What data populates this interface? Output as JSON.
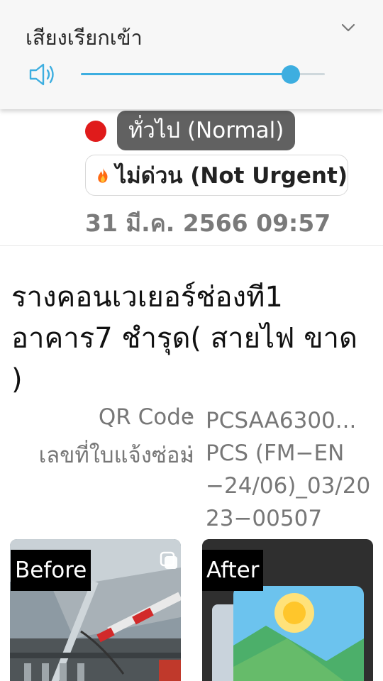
{
  "volume_panel": {
    "title": "เสียงเรียกเข้า",
    "level": 0.86
  },
  "status": {
    "type_label": "ทั่วไป (Normal)",
    "status_dot_color": "#e01b1b",
    "priority_label": "ไม่ด่วน (Not Urgent)",
    "datetime": "31 มี.ค. 2566 09:57"
  },
  "ticket": {
    "title": "รางคอนเวเยอร์ช่องที1 อาคาร7 ชำรุด( สายไฟ ขาด )",
    "qr_label": "QR Code",
    "qr_value": "PCSAA6300...",
    "doc_label": "เลขที่ใบแจ้งซ่อม",
    "doc_value": "PCS (FM−EN−24/06)_03/2023−00507",
    "colon": ":"
  },
  "photos": {
    "before_label": "Before",
    "after_label": "After"
  },
  "colors": {
    "accent": "#3daee0",
    "chip_bg": "#616161"
  },
  "icons": [
    "chevron-down-icon",
    "speaker-icon",
    "flame-icon",
    "multiple-images-icon",
    "image-placeholder-icon"
  ]
}
